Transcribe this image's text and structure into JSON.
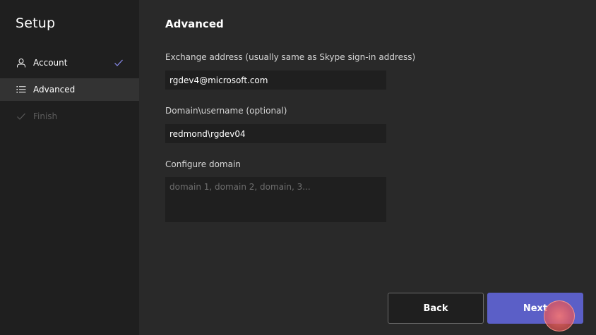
{
  "sidebar": {
    "title": "Setup",
    "items": [
      {
        "label": "Account",
        "icon": "person-icon",
        "completed": true
      },
      {
        "label": "Advanced",
        "icon": "list-icon",
        "selected": true
      },
      {
        "label": "Finish",
        "icon": "checkmark-icon",
        "disabled": true
      }
    ]
  },
  "main": {
    "title": "Advanced",
    "fields": {
      "exchange": {
        "label": "Exchange address (usually same as Skype sign-in address)",
        "value": "rgdev4@microsoft.com"
      },
      "domain_username": {
        "label": "Domain\\username (optional)",
        "value": "redmond\\rgdev04"
      },
      "configure_domain": {
        "label": "Configure domain",
        "value": "",
        "placeholder": "domain 1, domain 2, domain, 3..."
      }
    }
  },
  "buttons": {
    "back": "Back",
    "next": "Next"
  },
  "colors": {
    "accent": "#5b5fc7",
    "check": "#8b8df0",
    "sidebar_bg": "#1f1f1f",
    "main_bg": "#292929"
  }
}
